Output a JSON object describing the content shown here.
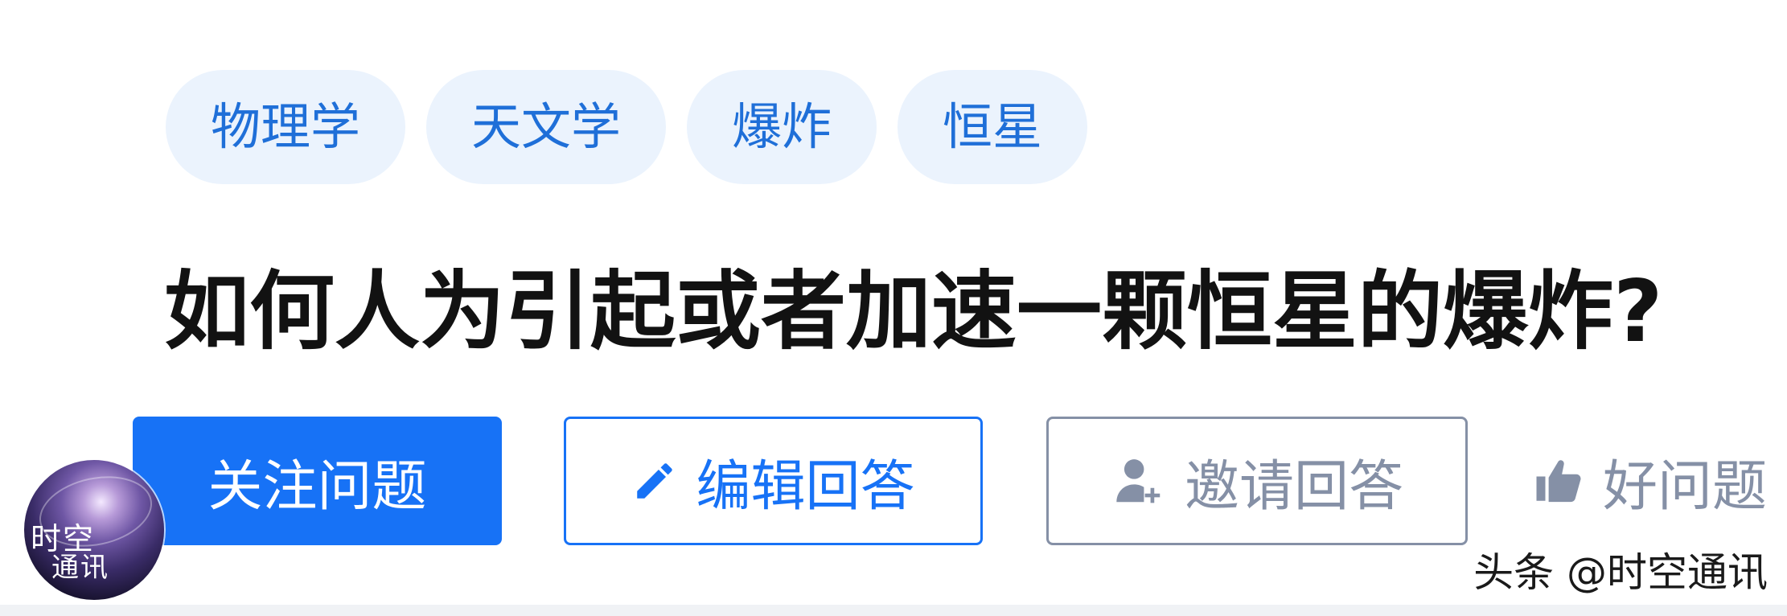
{
  "topics": [
    {
      "label": "物理学"
    },
    {
      "label": "天文学"
    },
    {
      "label": "爆炸"
    },
    {
      "label": "恒星"
    }
  ],
  "question": {
    "title": "如何人为引起或者加速一颗恒星的爆炸?"
  },
  "actions": {
    "follow_label": "关注问题",
    "edit_label": "编辑回答",
    "invite_label": "邀请回答",
    "good_label": "好问题"
  },
  "icons": {
    "edit": "pencil-icon",
    "invite": "add-user-icon",
    "good": "thumbs-up-icon"
  },
  "avatar": {
    "line1": "时空",
    "line2": "通讯"
  },
  "watermark": {
    "text": "头条 @时空通讯"
  },
  "colors": {
    "primary": "#1772f6",
    "tag_bg": "#ebf3fd",
    "tag_text": "#1f6fd8",
    "muted": "#8590a6",
    "title": "#121212"
  }
}
